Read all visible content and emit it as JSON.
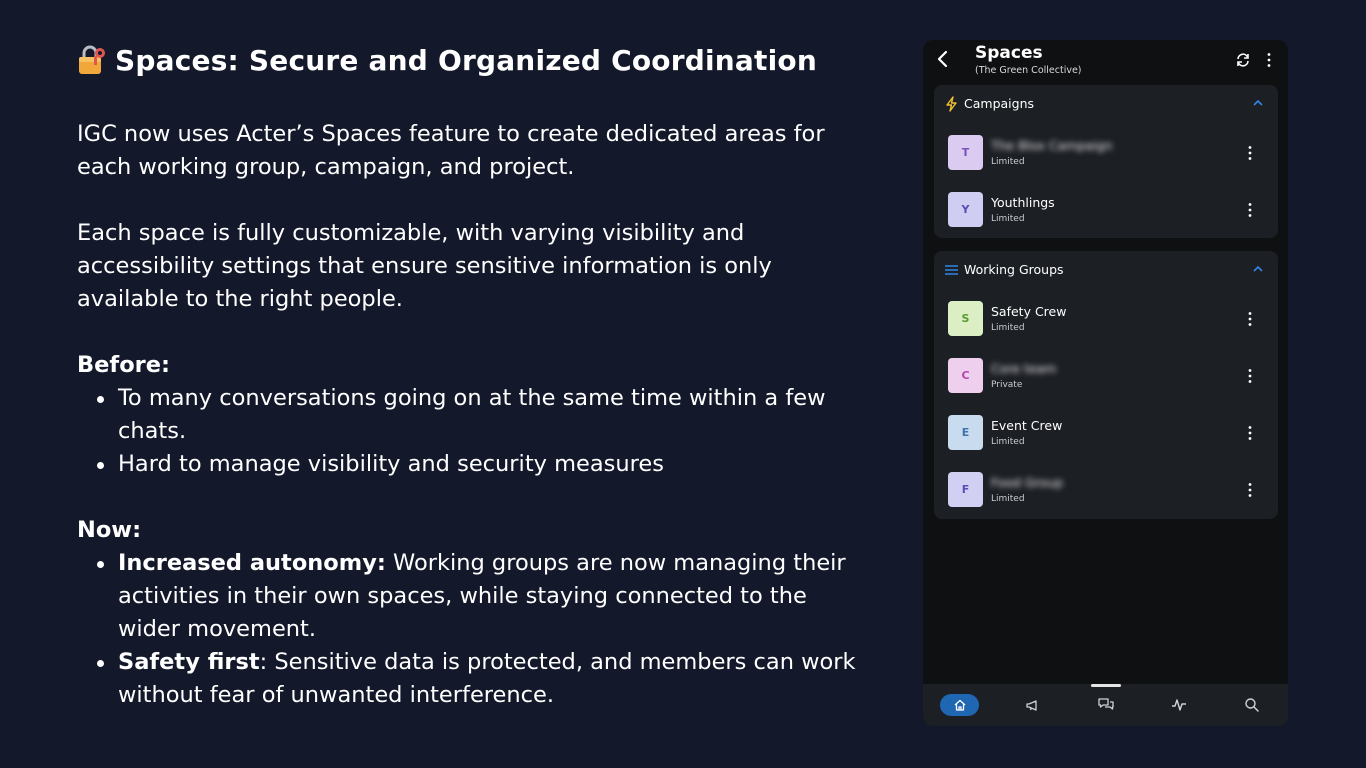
{
  "slide": {
    "title": "Spaces: Secure and Organized Coordination",
    "paragraph1": "IGC now uses Acter’s Spaces feature to create dedicated areas for each working group, campaign, and project.",
    "paragraph2": "Each space is fully customizable, with varying visibility and accessibility settings that ensure sensitive information is only available to the right people.",
    "before_heading": "Before:",
    "before_items": [
      "To many conversations going on at the same time within a few chats.",
      "Hard to manage visibility and security measures"
    ],
    "now_heading": "Now:",
    "now_items": [
      {
        "bold": "Increased autonomy:",
        "text": " Working groups are now managing their activities in their own spaces, while staying connected to the wider movement."
      },
      {
        "bold": "Safety first",
        "text": ": Sensitive data is protected, and members can work without fear of unwanted interference."
      }
    ]
  },
  "app": {
    "header": {
      "title": "Spaces",
      "subtitle": "(The Green Collective)"
    },
    "sections": [
      {
        "label": "Campaigns",
        "icon": "lightning-icon",
        "items": [
          {
            "initial": "T",
            "name": "The Blox Campaign",
            "status": "Limited",
            "blurred": true,
            "bg": "#dccbf0",
            "fg": "#7b53b8"
          },
          {
            "initial": "Y",
            "name": "Youthlings",
            "status": "Limited",
            "blurred": false,
            "bg": "#cfcdf1",
            "fg": "#5650b5"
          }
        ]
      },
      {
        "label": "Working Groups",
        "icon": "list-icon",
        "items": [
          {
            "initial": "S",
            "name": "Safety Crew",
            "status": "Limited",
            "blurred": false,
            "bg": "#dcefc4",
            "fg": "#5b9a2e"
          },
          {
            "initial": "C",
            "name": "Core team",
            "status": "Private",
            "blurred": true,
            "bg": "#efcfee",
            "fg": "#b347aa"
          },
          {
            "initial": "E",
            "name": "Event Crew",
            "status": "Limited",
            "blurred": false,
            "bg": "#c9dcef",
            "fg": "#3f74ad"
          },
          {
            "initial": "F",
            "name": "Food Group",
            "status": "Limited",
            "blurred": true,
            "bg": "#d2d0f2",
            "fg": "#5651b9"
          }
        ]
      }
    ],
    "bottom_nav": [
      "home-icon",
      "megaphone-icon",
      "chat-icon",
      "activity-icon",
      "search-icon"
    ]
  },
  "colors": {
    "background": "#14182b",
    "accent_yellow": "#f2c230",
    "accent_blue": "#2f86e6",
    "home_pill": "#1f66b3"
  }
}
